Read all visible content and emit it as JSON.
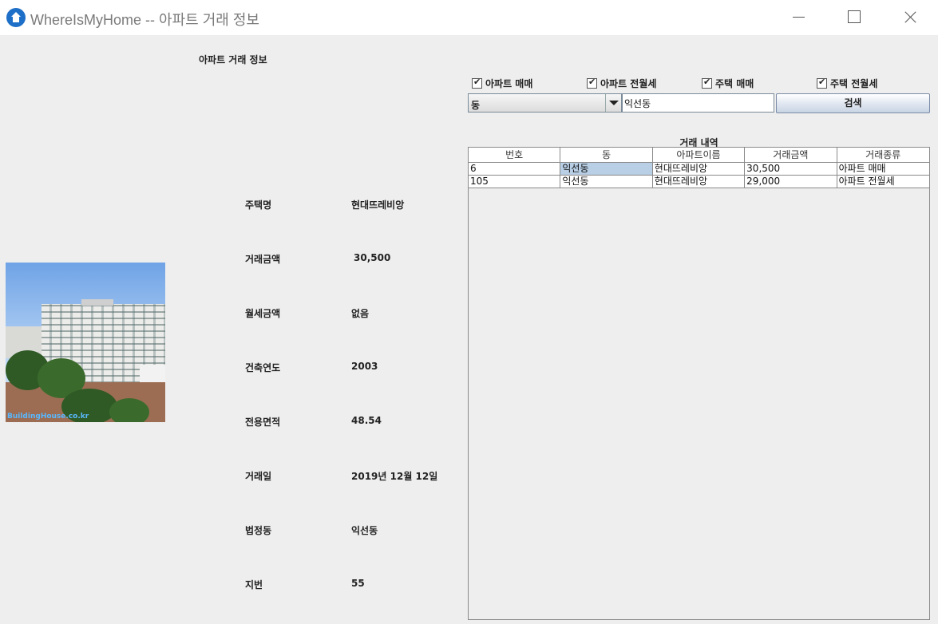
{
  "window": {
    "title": "WhereIsMyHome -- 아파트 거래 정보"
  },
  "left_panel": {
    "title": "아파트 거래 정보",
    "photo_watermark": "BuildingHouse.co.kr",
    "details": [
      {
        "label": "주택명",
        "value": "현대뜨레비앙"
      },
      {
        "label": "거래금액",
        "value": "30,500"
      },
      {
        "label": "월세금액",
        "value": "없음"
      },
      {
        "label": "건축연도",
        "value": "2003"
      },
      {
        "label": "전용면적",
        "value": "48.54"
      },
      {
        "label": "거래일",
        "value": "2019년 12월 12일"
      },
      {
        "label": "법정동",
        "value": "익선동"
      },
      {
        "label": "지번",
        "value": "55"
      }
    ]
  },
  "filters": [
    {
      "label": "아파트 매매",
      "checked": true
    },
    {
      "label": "아파트 전월세",
      "checked": true
    },
    {
      "label": "주택 매매",
      "checked": true
    },
    {
      "label": "주택 전월세",
      "checked": true
    }
  ],
  "search": {
    "select_value": "동",
    "input_value": "익선동",
    "button_label": "검색"
  },
  "history": {
    "title": "거래 내역",
    "columns": [
      "번호",
      "동",
      "아파트이름",
      "거래금액",
      "거래종류"
    ],
    "rows": [
      [
        "6",
        "익선동",
        "현대뜨레비앙",
        "30,500",
        "아파트 매매"
      ],
      [
        "105",
        "익선동",
        "현대뜨레비앙",
        "29,000",
        "아파트 전월세"
      ]
    ]
  },
  "colors": {
    "selected_cell": "#b8cfe5",
    "app_icon": "#1e6fc7"
  }
}
